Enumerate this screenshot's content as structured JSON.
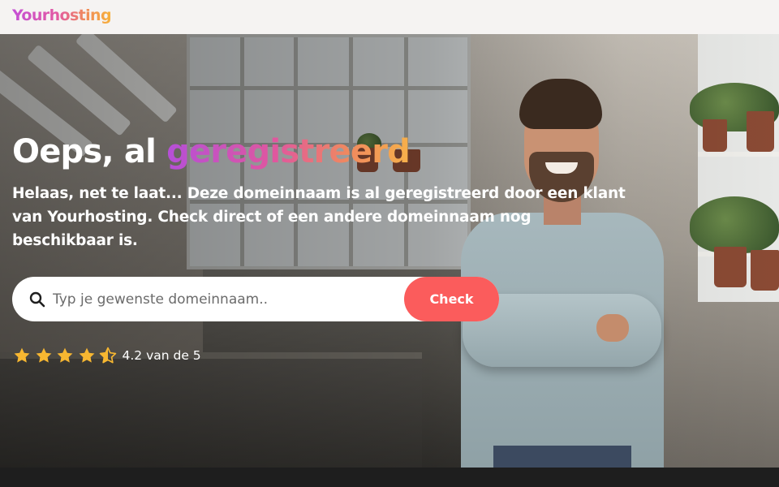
{
  "header": {
    "logo_text": "Yourhosting"
  },
  "hero": {
    "title_prefix": "Oeps, al ",
    "title_highlight": "geregistreerd",
    "subtitle": "Helaas, net te laat... Deze domeinnaam is al geregistreerd door een klant van Yourhosting. Check direct of een andere domeinnaam nog beschikbaar is.",
    "background_image": "man-with-crossed-arms-in-workshop"
  },
  "search": {
    "placeholder": "Typ je gewenste domeinnaam..",
    "value": "",
    "button_label": "Check",
    "icon": "search-icon"
  },
  "rating": {
    "score": 4.2,
    "max": 5,
    "text": "4.2 van de 5",
    "stars": [
      "full",
      "full",
      "full",
      "full",
      "half"
    ]
  },
  "colors": {
    "accent": "#fb5c5c",
    "gradient_start": "#b54fd8",
    "gradient_end": "#f6b04a",
    "star": "#f7b731",
    "header_bg": "#f5f3f2"
  }
}
